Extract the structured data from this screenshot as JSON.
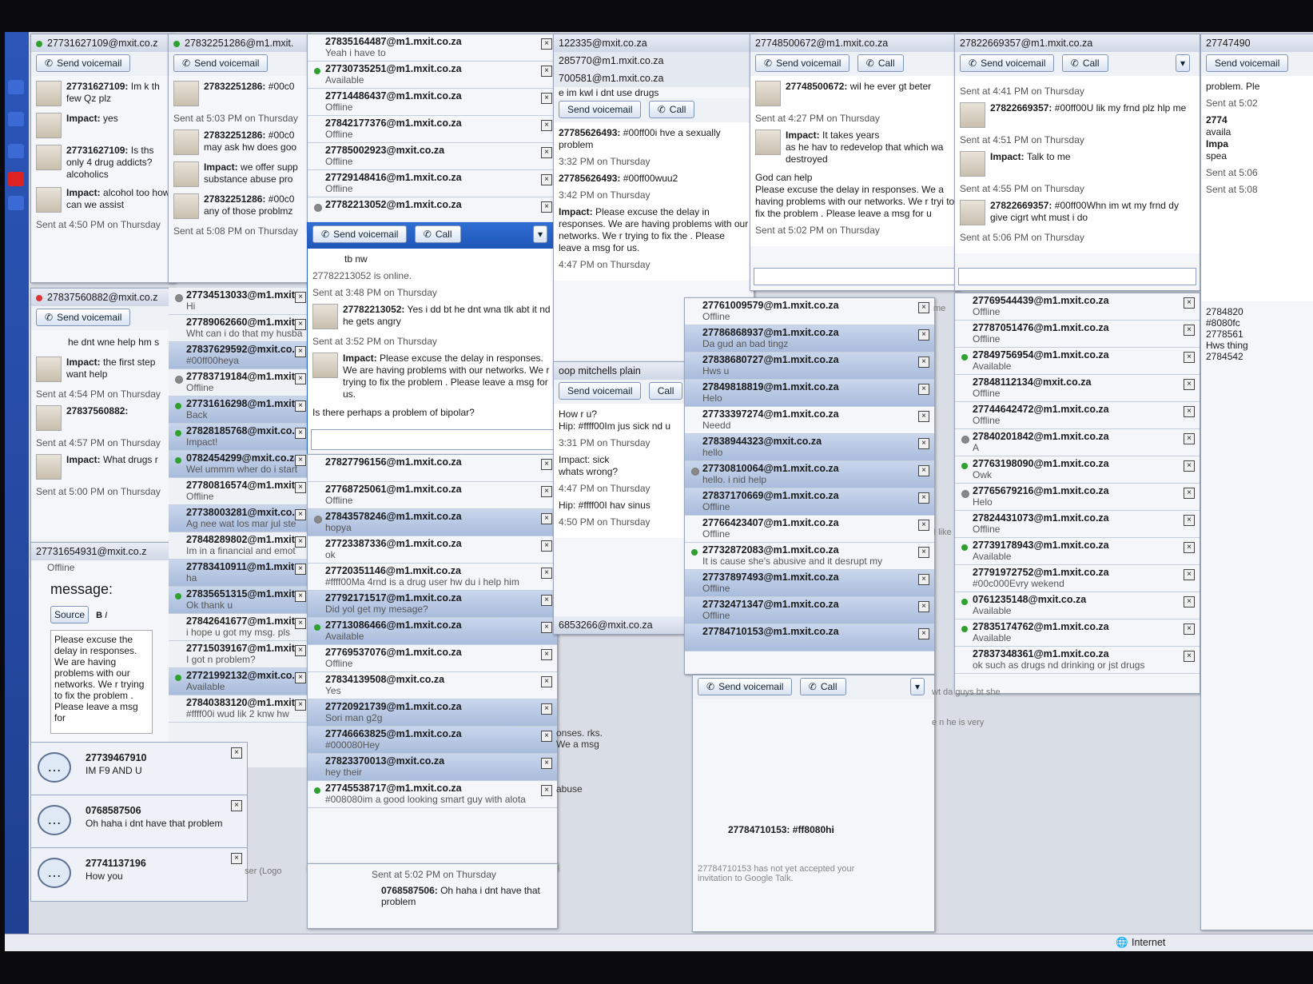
{
  "common": {
    "send_voicemail": "Send voicemail",
    "call": "Call",
    "sent_4_50": "Sent at 4:50 PM on Thursday",
    "sent_5_08": "Sent at 5:08 PM on Thursday"
  },
  "win1": {
    "title": "27731627109@mxit.co.z",
    "messages": [
      {
        "who": "27731627109:",
        "text": "Im k th few Qz plz"
      },
      {
        "who": "Impact:",
        "text": "yes"
      },
      {
        "who": "27731627109:",
        "text": "Is ths only 4 drug addicts? alcoholics"
      },
      {
        "who": "Impact:",
        "text": "alcohol too how can we assist"
      }
    ]
  },
  "win2": {
    "title": "27832251286@m1.mxit.",
    "sent": "Sent at 5:03 PM on Thursday",
    "messages": [
      {
        "who": "27832251286:",
        "text": "#00c0"
      },
      {
        "who": "27832251286:",
        "text": "#00c0 may ask hw does goo"
      },
      {
        "who": "Impact:",
        "text": "we offer supp substance abuse pro"
      },
      {
        "who": "27832251286:",
        "text": "#00c0 any of those problmz"
      }
    ]
  },
  "win3": {
    "title": "27837560882@mxit.co.z",
    "messages": [
      {
        "who": "",
        "text": "he dnt wne help hm s"
      },
      {
        "who": "Impact:",
        "text": "the first step want help"
      },
      {
        "who": "27837560882:",
        "text": ""
      },
      {
        "who": "Impact:",
        "text": "What drugs r"
      }
    ],
    "sent1": "Sent at 4:54 PM on Thursday",
    "sent2": "Sent at 4:57 PM on Thursday",
    "sent3": "Sent at 5:00 PM on Thursday"
  },
  "win4": {
    "title": "27731654931@mxit.co.z",
    "status": "Offline",
    "message_label": "message:",
    "source": "Source",
    "body": "Please excuse the delay in responses. We are having problems with our networks. We r trying to fix the problem . Please leave a msg for"
  },
  "list_mid": [
    {
      "name": "27734513033@m1.mxit.co.z",
      "status": "Hi",
      "dot": "o"
    },
    {
      "name": "27789062660@m1.mxit.c",
      "status": "Wht can i do that my husba",
      "dot": ""
    },
    {
      "name": "27837629592@mxit.co.z",
      "status": "#00ff00heya",
      "dot": "",
      "sel": true
    },
    {
      "name": "27783719184@m1.mxit.c",
      "status": "Offline",
      "dot": "o"
    },
    {
      "name": "27731616298@m1.mxit.",
      "status": "Back",
      "dot": "g",
      "sel": true
    },
    {
      "name": "27828185768@mxit.co.z",
      "status": "Impact!",
      "dot": "g",
      "sel": true
    },
    {
      "name": "0782454299@mxit.co.za",
      "status": "Wel ummm wher do i start",
      "dot": "g",
      "sel": true
    },
    {
      "name": "27780816574@m1.mxit.c",
      "status": "Offline",
      "dot": ""
    },
    {
      "name": "27738003281@mxit.co.z",
      "status": "Ag nee wat los mar jul ste",
      "dot": "",
      "sel": true
    },
    {
      "name": "27848289802@m1.mxit.c",
      "status": "Im in a financial and emot",
      "dot": ""
    },
    {
      "name": "27783410911@m1.mxit.",
      "status": "ha",
      "dot": "",
      "sel": true
    },
    {
      "name": "27835651315@m1.mxit.",
      "status": "Ok thank u",
      "dot": "g",
      "sel": true
    },
    {
      "name": "27842641677@m1.mxit.",
      "status": "i hope u got my msg. pls",
      "dot": ""
    },
    {
      "name": "27715039167@m1.mxit.",
      "status": "I got n problem?",
      "dot": ""
    },
    {
      "name": "27721992132@mxit.co.z",
      "status": "Available",
      "dot": "g",
      "sel": true
    },
    {
      "name": "27840383120@m1.mxit.",
      "status": "#ffff00i wud lik 2 knw hw",
      "dot": ""
    }
  ],
  "notifications": [
    {
      "who": "27739467910",
      "text": "IM F9 AND U"
    },
    {
      "who": "0768587506",
      "text": "Oh haha i dnt have that problem"
    },
    {
      "who": "27741137196",
      "text": "How you"
    }
  ],
  "main_list": [
    {
      "name": "27835164487@m1.mxit.co.za",
      "status": "Yeah i have to",
      "dot": ""
    },
    {
      "name": "27730735251@m1.mxit.co.za",
      "status": "Available",
      "dot": "g"
    },
    {
      "name": "27714486437@m1.mxit.co.za",
      "status": "Offline",
      "dot": ""
    },
    {
      "name": "27842177376@m1.mxit.co.za",
      "status": "Offline",
      "dot": ""
    },
    {
      "name": "27785002923@mxit.co.za",
      "status": "Offline",
      "dot": ""
    },
    {
      "name": "27729148416@m1.mxit.co.za",
      "status": "Offline",
      "dot": ""
    },
    {
      "name": "27782213052@m1.mxit.co.za",
      "status": "",
      "dot": "o"
    }
  ],
  "main_chat": {
    "msgs_top": "tb nw",
    "online": "27782213052 is online.",
    "sent1": "Sent at 3:48 PM on Thursday",
    "m1_who": "27782213052:",
    "m1_text": "Yes i dd bt he dnt wna tlk abt it nd he gets angry",
    "sent2": "Sent at 3:52 PM on Thursday",
    "m2_who": "Impact:",
    "m2_text": "Please excuse the delay in responses. We are having problems with our networks. We r trying to fix the problem . Please leave a msg for us.",
    "m3": "Is there perhaps a problem of bipolar?"
  },
  "main_list2": [
    {
      "name": "27827796156@m1.mxit.co.za",
      "status": "",
      "dot": ""
    },
    {
      "name": "27768725061@m1.mxit.co.za",
      "status": "Offline",
      "dot": ""
    },
    {
      "name": "27843578246@m1.mxit.co.za",
      "status": "hopya",
      "dot": "o",
      "sel": true
    },
    {
      "name": "27723387336@m1.mxit.co.za",
      "status": "ok",
      "dot": ""
    },
    {
      "name": "27720351146@m1.mxit.co.za",
      "status": "#ffff00Ma 4rnd is a drug user hw du i help him",
      "dot": ""
    },
    {
      "name": "27792171517@m1.mxit.co.za",
      "status": "Did yol get my mesage?",
      "dot": "",
      "sel": true
    },
    {
      "name": "27713086466@m1.mxit.co.za",
      "status": "Available",
      "dot": "g",
      "sel": true
    },
    {
      "name": "27769537076@m1.mxit.co.za",
      "status": "Offline",
      "dot": ""
    },
    {
      "name": "27834139508@mxit.co.za",
      "status": "Yes",
      "dot": ""
    },
    {
      "name": "27720921739@m1.mxit.co.za",
      "status": "Sori man g2g",
      "dot": "",
      "sel": true
    },
    {
      "name": "27746663825@m1.mxit.co.za",
      "status": "#000080Hey",
      "dot": "",
      "sel": true
    },
    {
      "name": "27823370013@mxit.co.za",
      "status": "hey their",
      "dot": "",
      "sel": true
    },
    {
      "name": "27745538717@m1.mxit.co.za",
      "status": "#008080im a good looking smart guy with alota",
      "dot": "g"
    }
  ],
  "win5": {
    "titles": [
      "122335@mxit.co.za",
      "285770@m1.mxit.co.za",
      "700581@m1.mxit.co.za"
    ],
    "line": "e im kwl i dnt use drugs",
    "msgs": [
      {
        "who": "27785626493:",
        "text": "#00ff00i hve a sexually problem"
      },
      {
        "sent": "3:32 PM on Thursday"
      },
      {
        "who": "27785626493:",
        "text": "#00ff00wuu2"
      },
      {
        "sent": "3:42 PM on Thursday"
      },
      {
        "who": "Impact:",
        "text": "Please excuse the delay in responses. We are having problems with our networks. We r trying to fix the . Please leave a msg for us."
      },
      {
        "sent": "4:47 PM on Thursday"
      }
    ]
  },
  "win6": {
    "title": "oop mitchells plain",
    "lines": [
      "How r u?",
      "Hip: #ffff00Im jus sick nd u",
      "3:31 PM on Thursday",
      "Impact: sick",
      "whats wrong?",
      "4:47 PM on Thursday",
      "Hip: #ffff00I hav sinus",
      "4:50 PM on Thursday"
    ],
    "footer": "6853266@mxit.co.za"
  },
  "win7": {
    "title": "27748500672@m1.mxit.co.za",
    "m1_who": "27748500672:",
    "m1_text": "wil he ever gt beter",
    "sent1": "Sent at 4:27 PM on Thursday",
    "m2_who": "Impact:",
    "m2_text": "It takes years",
    "m2b": "as he hav to redevelop that which wa destroyed",
    "m3": "God can help",
    "m4": "Please excuse the delay in responses. We a having problems with our networks. We r tryi to fix the problem . Please leave a msg for u",
    "sent2": "Sent at 5:02 PM on Thursday"
  },
  "list_right_mid": [
    {
      "name": "27761009579@m1.mxit.co.za",
      "status": "Offline",
      "dot": ""
    },
    {
      "name": "27786868937@m1.mxit.co.za",
      "status": "Da gud an bad tingz",
      "dot": "",
      "sel": true
    },
    {
      "name": "27838680727@m1.mxit.co.za",
      "status": "Hws u",
      "dot": "",
      "sel": true
    },
    {
      "name": "27849818819@m1.mxit.co.za",
      "status": "Helo",
      "dot": "",
      "sel": true
    },
    {
      "name": "27733397274@m1.mxit.co.za",
      "status": "Needd",
      "dot": ""
    },
    {
      "name": "27838944323@mxit.co.za",
      "status": "hello",
      "dot": "",
      "sel": true
    },
    {
      "name": "27730810064@m1.mxit.co.za",
      "status": "hello. i nid help",
      "dot": "o",
      "sel": true
    },
    {
      "name": "27837170669@m1.mxit.co.za",
      "status": "Offline",
      "dot": "",
      "sel": true
    },
    {
      "name": "27766423407@m1.mxit.co.za",
      "status": "Offline",
      "dot": ""
    },
    {
      "name": "27732872083@m1.mxit.co.za",
      "status": "It is cause she's abusive and it desrupt my",
      "dot": "g"
    },
    {
      "name": "27737897493@m1.mxit.co.za",
      "status": "Offline",
      "dot": "",
      "sel": true
    },
    {
      "name": "27732471347@m1.mxit.co.za",
      "status": "Offline",
      "dot": "",
      "sel": true
    },
    {
      "name": "27784710153@m1.mxit.co.za",
      "status": "",
      "dot": "",
      "sel": true
    }
  ],
  "win8": {
    "title": "27822669357@m1.mxit.co.za",
    "sent1": "Sent at 4:41 PM on Thursday",
    "m1_who": "27822669357:",
    "m1_text": "#00ff00U lik my frnd plz hlp me",
    "sent2": "Sent at 4:51 PM on Thursday",
    "m2_who": "Impact:",
    "m2_text": "Talk to me",
    "sent3": "Sent at 4:55 PM on Thursday",
    "m3_who": "27822669357:",
    "m3_text": "#00ff00Whn im wt my frnd dy give cigrt wht must i do",
    "sent4": "Sent at 5:06 PM on Thursday"
  },
  "list_right": [
    {
      "name": "27769544439@m1.mxit.co.za",
      "status": "Offline",
      "dot": ""
    },
    {
      "name": "27787051476@m1.mxit.co.za",
      "status": "Offline",
      "dot": ""
    },
    {
      "name": "27849756954@m1.mxit.co.za",
      "status": "Available",
      "dot": "g"
    },
    {
      "name": "27848112134@mxit.co.za",
      "status": "Offline",
      "dot": ""
    },
    {
      "name": "27744642472@m1.mxit.co.za",
      "status": "Offline",
      "dot": ""
    },
    {
      "name": "27840201842@m1.mxit.co.za",
      "status": "A",
      "dot": "o"
    },
    {
      "name": "27763198090@m1.mxit.co.za",
      "status": "Owk",
      "dot": "g"
    },
    {
      "name": "27765679216@m1.mxit.co.za",
      "status": "Helo",
      "dot": "o"
    },
    {
      "name": "27824431073@m1.mxit.co.za",
      "status": "Offline",
      "dot": ""
    },
    {
      "name": "27739178943@m1.mxit.co.za",
      "status": "Available",
      "dot": "g"
    },
    {
      "name": "27791972752@m1.mxit.co.za",
      "status": "#00c000Evry wekend",
      "dot": ""
    },
    {
      "name": "0761235148@mxit.co.za",
      "status": "Available",
      "dot": "g"
    },
    {
      "name": "27835174762@m1.mxit.co.za",
      "status": "Available",
      "dot": "g"
    },
    {
      "name": "27837348361@m1.mxit.co.za",
      "status": "ok such as drugs nd drinking or jst drugs",
      "dot": ""
    }
  ],
  "far_right": {
    "title": "27747490",
    "line1": "problem. Ple",
    "sent1": "Sent at 5:02",
    "l2": "2774",
    "l3": "availa",
    "l4": "Impa",
    "l5": "spea",
    "sent2": "Sent at 5:06",
    "sent3": "Sent at 5:08",
    "items": [
      "2784820",
      "#8080fc",
      "2778561",
      "Hws thing",
      "2784542"
    ]
  },
  "bottom_chat": {
    "msg_who": "27784710153:",
    "msg_text": "#ff8080hi",
    "info": "27784710153 has not yet accepted your invitation to Google Talk."
  },
  "bottom_mid": {
    "sent": "Sent at 5:02 PM on Thursday",
    "who": "0768587506:",
    "text": "Oh haha i dnt have that problem",
    "abuse": "abuse",
    "onses": "onses. rks. We a msg"
  },
  "misc_lines": [
    "wt da guys bt she",
    "e n he is very",
    "me",
    "I like",
    "ser (Logo"
  ],
  "status_bar": {
    "zone": "Internet"
  }
}
